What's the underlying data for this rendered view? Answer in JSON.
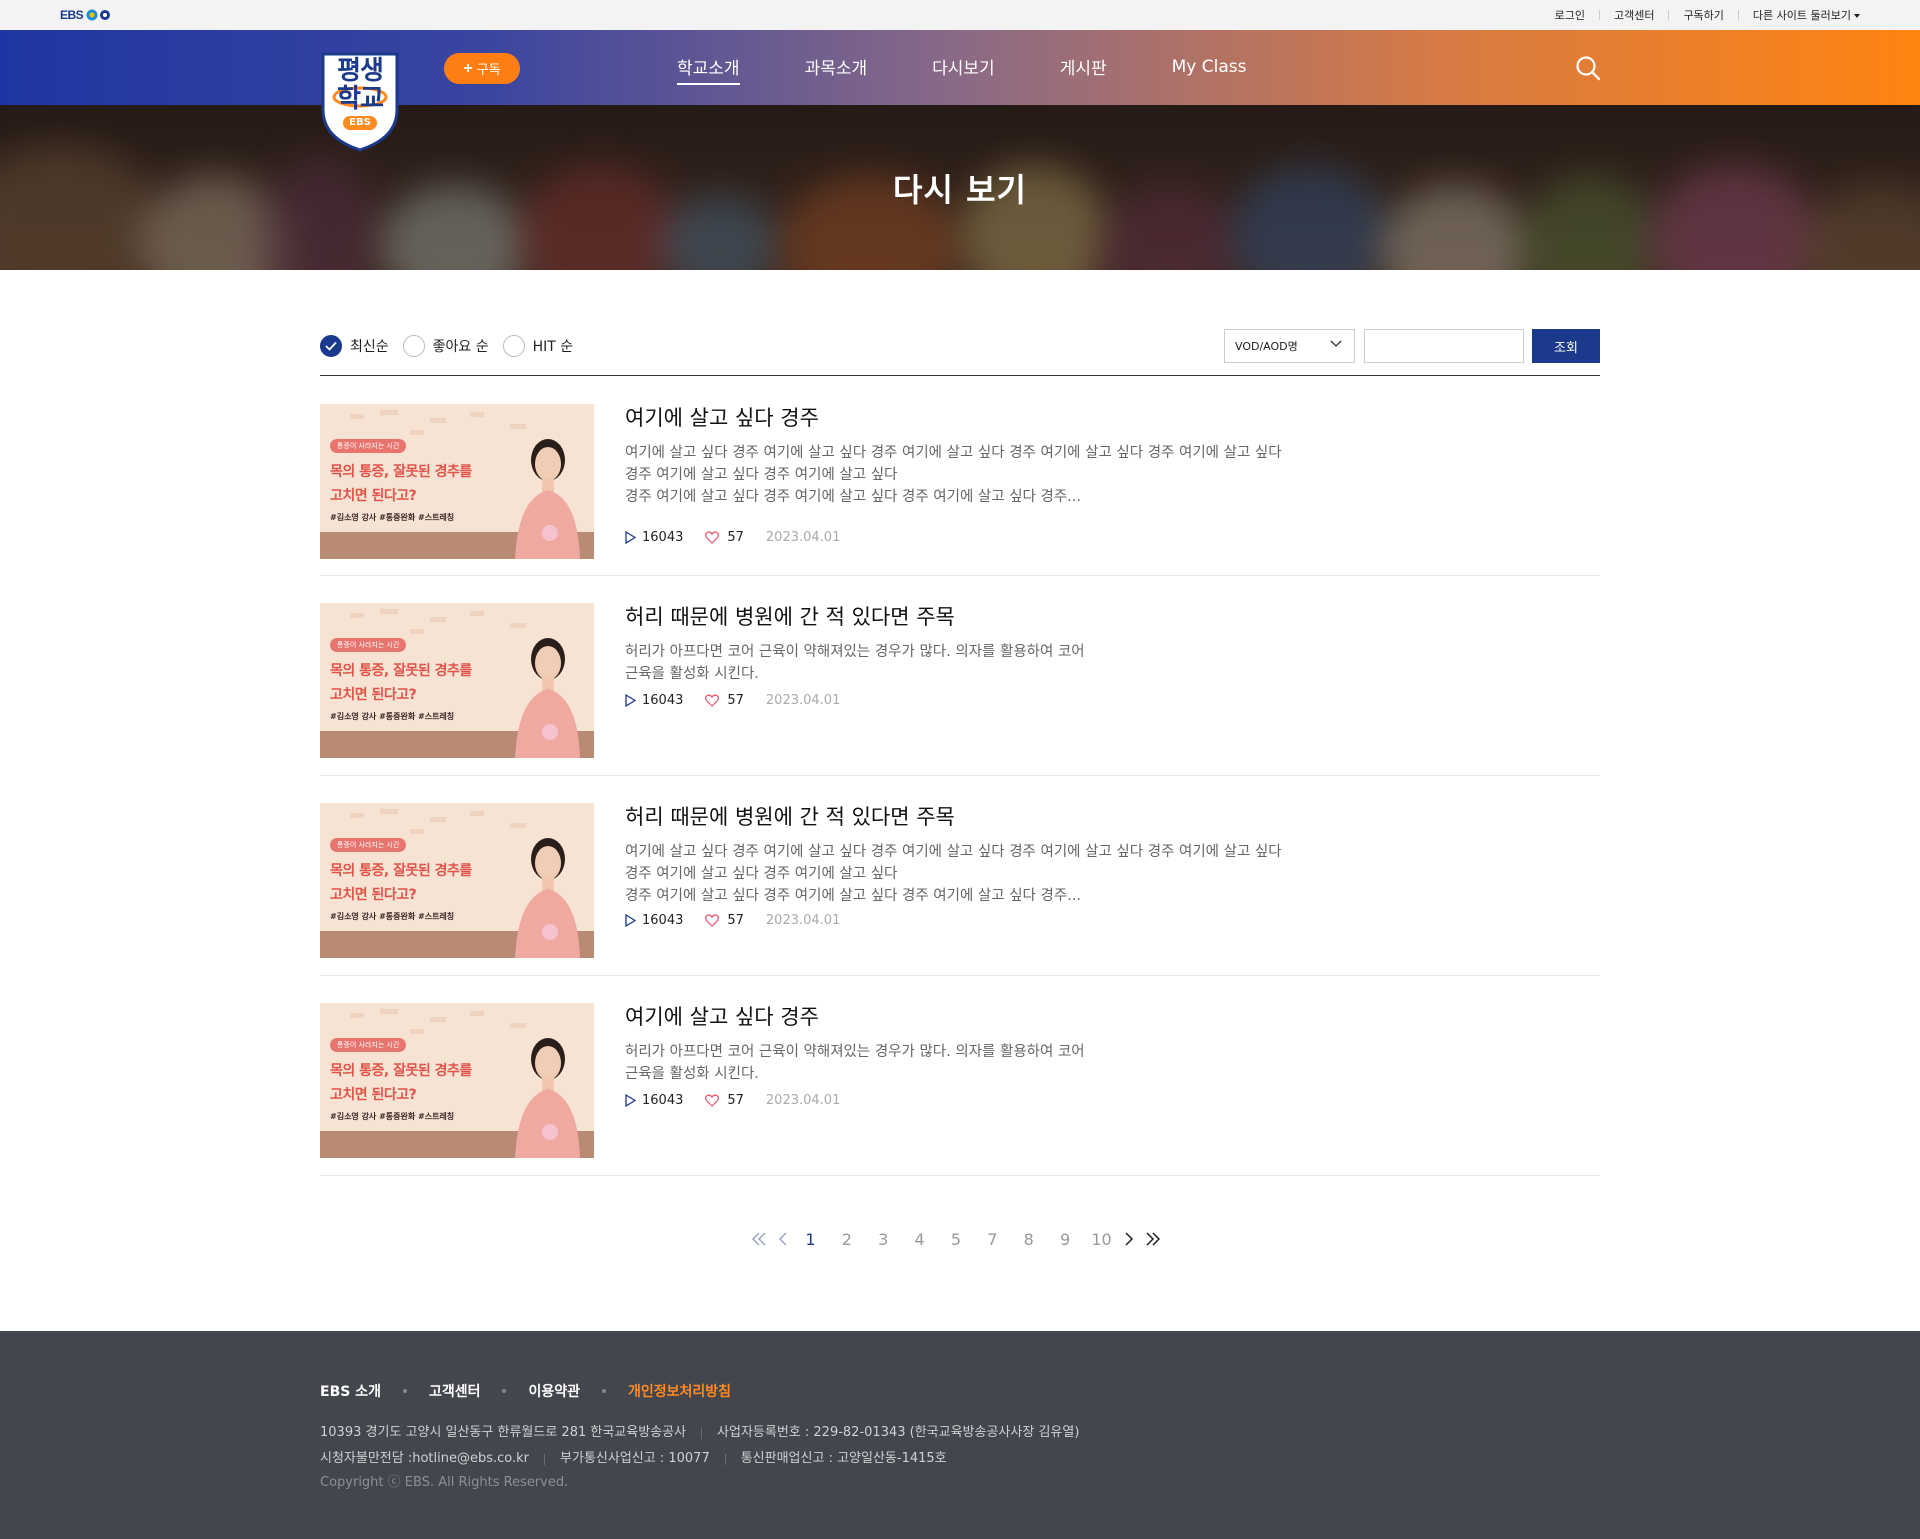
{
  "util_bar": {
    "logo_text": "EBS",
    "links": [
      "로그인",
      "고객센터",
      "구독하기",
      "다른 사이트 둘러보기"
    ]
  },
  "header": {
    "logo_lines": [
      "평생",
      "학교",
      "EBS"
    ],
    "subscribe_label": "구독",
    "nav": [
      {
        "label": "학교소개",
        "active": true
      },
      {
        "label": "과목소개",
        "active": false
      },
      {
        "label": "다시보기",
        "active": false
      },
      {
        "label": "게시판",
        "active": false
      },
      {
        "label": "My Class",
        "active": false
      }
    ]
  },
  "hero": {
    "title": "다시 보기"
  },
  "filter": {
    "sort_options": [
      {
        "label": "최신순",
        "checked": true
      },
      {
        "label": "좋아요 순",
        "checked": false
      },
      {
        "label": "HIT 순",
        "checked": false
      }
    ],
    "select_value": "VOD/AOD명",
    "search_value": "",
    "query_label": "조회"
  },
  "thumbnail": {
    "tag": "통증이 사라지는 시간",
    "line1": "목의 통증, 잘못된 경추를",
    "line2": "고치면 된다고?",
    "line3": "#김소영 강사 #통증완화 #스트레칭"
  },
  "items": [
    {
      "title": "여기에 살고 싶다 경주",
      "desc": [
        "여기에 살고 싶다 경주 여기에 살고 싶다 경주 여기에 살고 싶다 경주 여기에 살고 싶다 경주 여기에 살고 싶다",
        "경주 여기에 살고 싶다 경주 여기에 살고 싶다",
        "경주 여기에 살고 싶다 경주 여기에 살고 싶다 경주 여기에 살고 싶다 경주..."
      ],
      "views": "16043",
      "likes": "57",
      "date": "2023.04.01"
    },
    {
      "title": "허리 때문에 병원에 간 적 있다면 주목",
      "desc": [
        "허리가 아프다면 코어 근육이 약해져있는 경우가 많다. 의자를 활용하여 코어",
        "근육을 활성화 시킨다."
      ],
      "views": "16043",
      "likes": "57",
      "date": "2023.04.01"
    },
    {
      "title": "허리 때문에 병원에 간 적 있다면 주목",
      "desc": [
        "여기에 살고 싶다 경주 여기에 살고 싶다 경주 여기에 살고 싶다 경주 여기에 살고 싶다 경주 여기에 살고 싶다",
        "경주 여기에 살고 싶다 경주 여기에 살고 싶다",
        "경주 여기에 살고 싶다 경주 여기에 살고 싶다 경주 여기에 살고 싶다 경주..."
      ],
      "views": "16043",
      "likes": "57",
      "date": "2023.04.01"
    },
    {
      "title": "여기에 살고 싶다 경주",
      "desc": [
        "허리가 아프다면 코어 근육이 약해져있는 경우가 많다. 의자를 활용하여 코어",
        "근육을 활성화 시킨다."
      ],
      "views": "16043",
      "likes": "57",
      "date": "2023.04.01"
    }
  ],
  "pagination": {
    "pages": [
      "1",
      "2",
      "3",
      "4",
      "5",
      "7",
      "8",
      "9",
      "10"
    ],
    "current": "1"
  },
  "footer": {
    "links": [
      "EBS 소개",
      "고객센터",
      "이용약관",
      "개인정보처리방침"
    ],
    "address": "10393 경기도 고양시 일산동구 한류월드로 281 한국교육방송공사",
    "biz_no": "사업자등록번호 : 229-82-01343 (한국교육방송공사사장 김유열)",
    "hotline": "시청자불만전담 :hotline@ebs.co.kr",
    "telecom": "부가통신사업신고 : 10077",
    "ecommerce": "통신판매업신고 : 고양일산동-1415호",
    "copyright": "Copyright ⓒ EBS. All Rights Reserved."
  },
  "colors": {
    "brand_navy": "#1b3a8c",
    "accent_orange": "#ff7e14",
    "footer_bg": "#44464d"
  }
}
